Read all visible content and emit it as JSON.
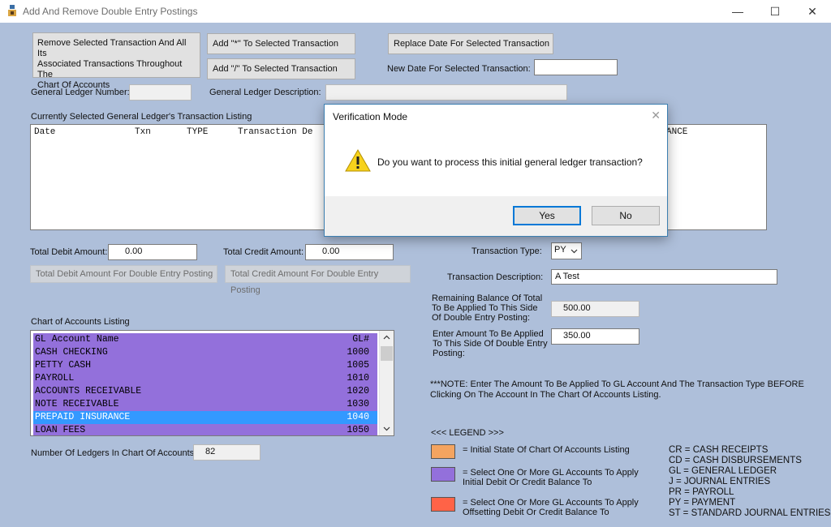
{
  "window": {
    "title": "Add And Remove Double Entry Postings",
    "minimize": "—",
    "maximize": "☐",
    "close": "✕"
  },
  "buttons": {
    "remove_selected": [
      "Remove Selected Transaction And All Its",
      "Associated Transactions Throughout The",
      "Chart Of Accounts"
    ],
    "add_star": "Add \"*\" To Selected Transaction",
    "add_slash": "Add \"/\" To Selected Transaction",
    "replace_date": "Replace Date For Selected Transaction",
    "total_debit_posting": "Total Debit Amount For Double Entry Posting",
    "total_credit_posting": "Total Credit Amount For Double Entry Posting"
  },
  "labels": {
    "new_date": "New Date For Selected Transaction:",
    "gl_number": "General Ledger Number:",
    "gl_description": "General Ledger Description:",
    "current_listing": "Currently Selected General Ledger's Transaction Listing",
    "total_debit": "Total Debit Amount:",
    "total_credit": "Total Credit Amount:",
    "transaction_type": "Transaction Type:",
    "transaction_description": "Transaction Description:",
    "remaining_balance": [
      "Remaining Balance Of Total",
      "To Be Applied To This Side",
      "Of Double Entry Posting:"
    ],
    "enter_amount": [
      "Enter Amount To Be Applied",
      "To This Side Of Double Entry",
      "Posting:"
    ],
    "chart_listing": "Chart of Accounts Listing",
    "num_ledgers": "Number Of Ledgers In Chart Of Accounts:",
    "note": [
      "***NOTE: Enter The Amount To Be Applied To GL Account And The Transaction Type BEFORE",
      "Clicking On The Account In The Chart Of Accounts Listing."
    ]
  },
  "fields": {
    "new_date": "",
    "gl_number": "",
    "gl_description": "",
    "total_debit": "0.00",
    "total_credit": "0.00",
    "transaction_type": "PY",
    "transaction_description": "A Test",
    "remaining_balance": "500.00",
    "enter_amount": "350.00",
    "num_ledgers": "82"
  },
  "transaction_listing": {
    "headers": [
      "Date",
      "Txn",
      "TYPE",
      "Transaction De",
      "ANCE"
    ]
  },
  "chart_of_accounts": {
    "header": {
      "name": "GL Account Name",
      "gl": "GL#"
    },
    "rows": [
      {
        "name": "CASH CHECKING",
        "gl": "1000",
        "selected": false
      },
      {
        "name": "PETTY CASH",
        "gl": "1005",
        "selected": false
      },
      {
        "name": "PAYROLL",
        "gl": "1010",
        "selected": false
      },
      {
        "name": "ACCOUNTS RECEIVABLE",
        "gl": "1020",
        "selected": false
      },
      {
        "name": "NOTE RECEIVABLE",
        "gl": "1030",
        "selected": false
      },
      {
        "name": "PREPAID INSURANCE",
        "gl": "1040",
        "selected": true
      },
      {
        "name": "LOAN FEES",
        "gl": "1050",
        "selected": false
      }
    ]
  },
  "legend": {
    "title": "<<< LEGEND >>>",
    "items": [
      {
        "color": "#f4a460",
        "text": [
          "= Initial State Of Chart Of Accounts Listing"
        ]
      },
      {
        "color": "#9370db",
        "text": [
          "= Select One Or More GL Accounts To Apply",
          "Initial Debit Or Credit Balance To"
        ]
      },
      {
        "color": "#ff6347",
        "text": [
          "= Select One Or More GL Accounts To Apply",
          "Offsetting Debit Or Credit Balance To"
        ]
      }
    ],
    "codes": [
      "CR = CASH RECEIPTS",
      "CD = CASH DISBURSEMENTS",
      "GL = GENERAL LEDGER",
      "J = JOURNAL ENTRIES",
      "PR = PAYROLL",
      "PY = PAYMENT",
      "ST = STANDARD JOURNAL ENTRIES"
    ]
  },
  "dialog": {
    "title": "Verification Mode",
    "message": "Do you want to process this initial general ledger transaction?",
    "yes": "Yes",
    "no": "No",
    "close": "✕"
  }
}
